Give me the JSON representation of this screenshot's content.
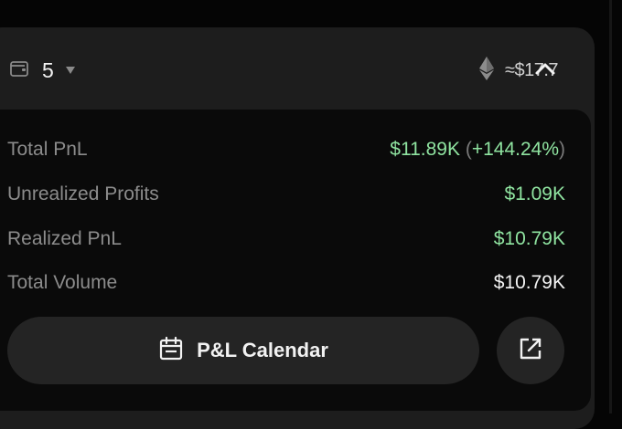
{
  "header": {
    "wallet_count": "5",
    "balance": "≈$17.7"
  },
  "stats": [
    {
      "label": "Total PnL",
      "value": "$11.89K",
      "pct_open": "(",
      "pct": "+144.24%",
      "pct_close": ")"
    },
    {
      "label": "Unrealized Profits",
      "value": "$1.09K"
    },
    {
      "label": "Realized PnL",
      "value": "$10.79K"
    },
    {
      "label": "Total Volume",
      "value": "$10.79K"
    }
  ],
  "actions": {
    "calendar_label": "P&L Calendar"
  },
  "colors": {
    "positive": "#8fe3a0",
    "card_bg": "#1d1d1d",
    "panel_bg": "#0a0a0a",
    "button_bg": "#242424"
  },
  "icons": [
    "wallet-icon",
    "caret-down-icon",
    "ethereum-icon",
    "chevron-up-icon",
    "calendar-icon",
    "external-link-icon"
  ]
}
